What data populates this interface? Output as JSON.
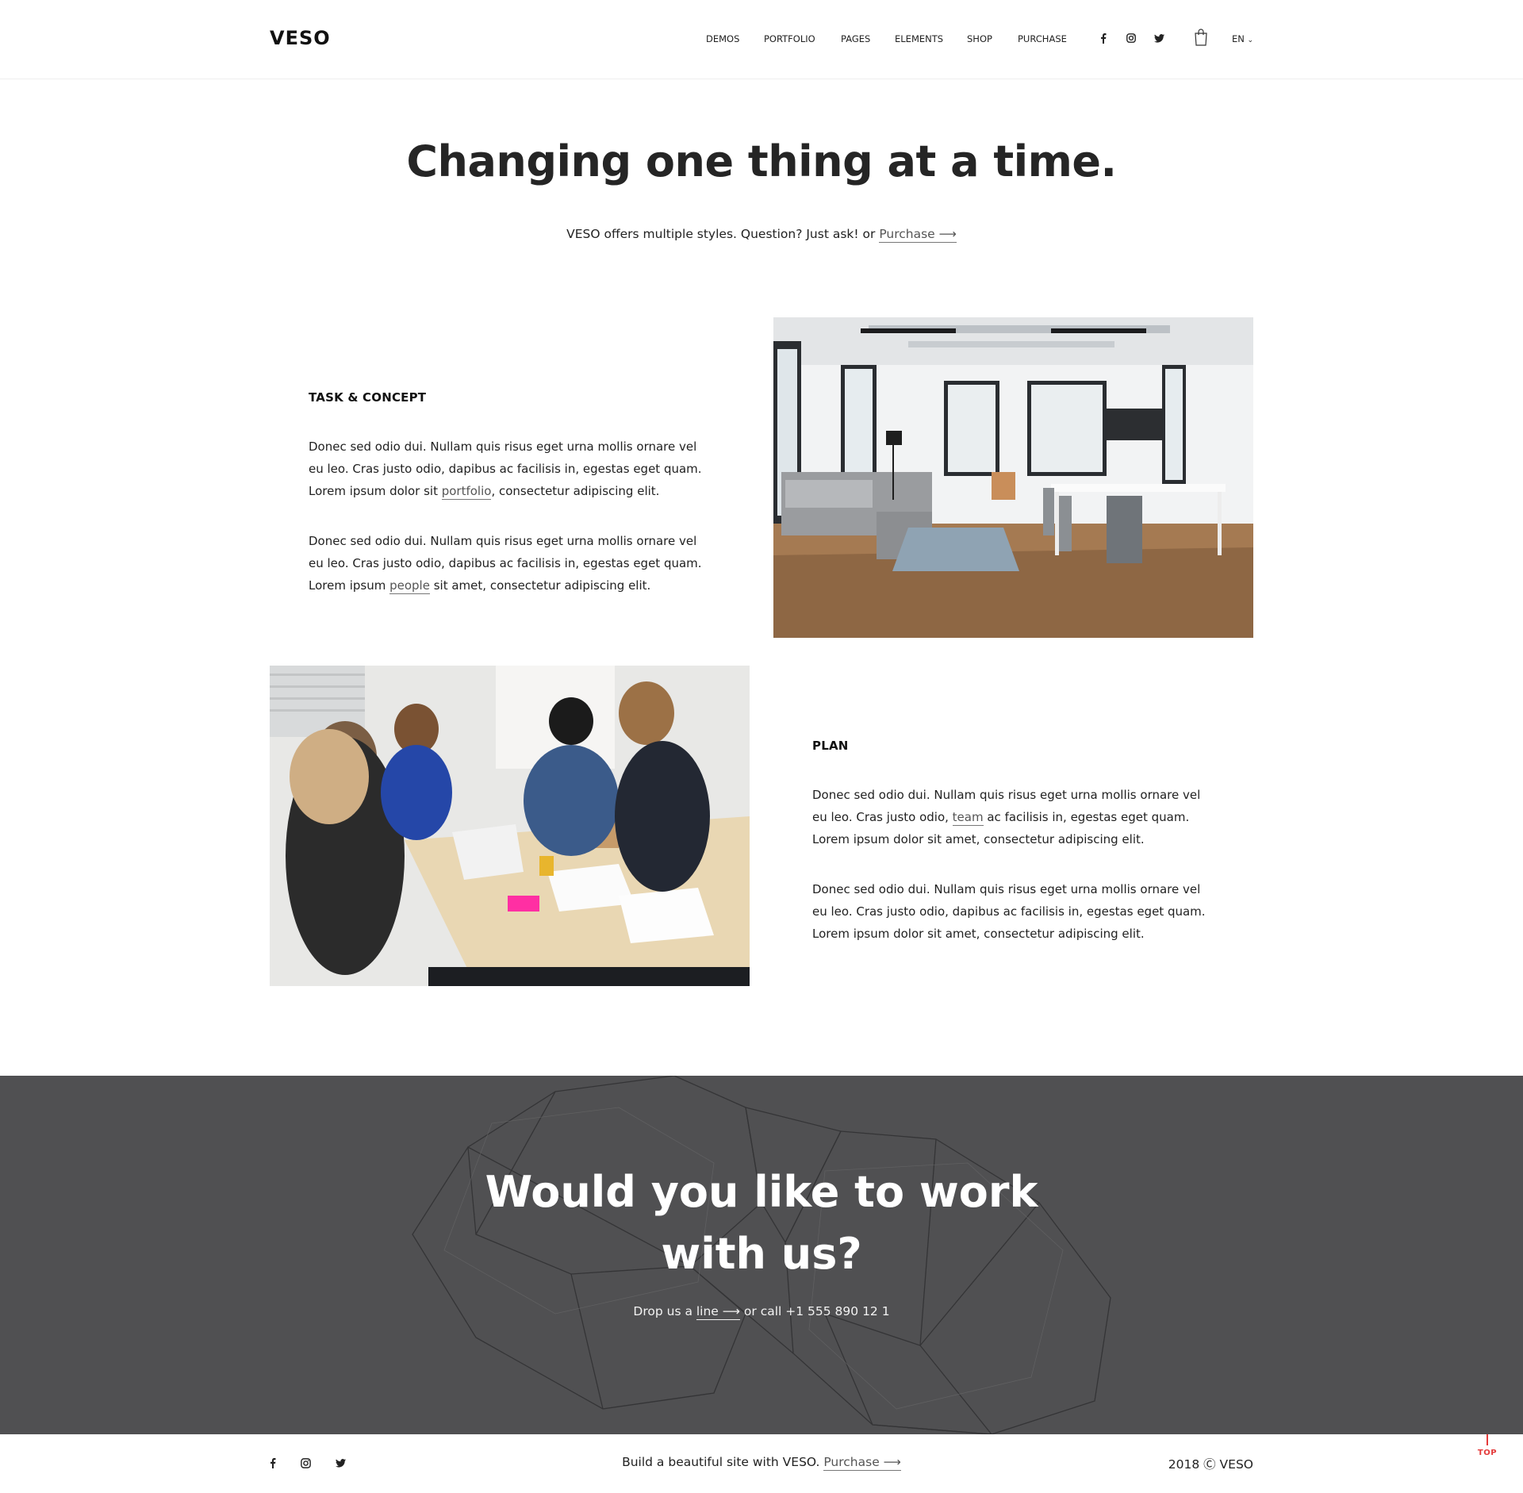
{
  "header": {
    "logo": "VESO",
    "nav": [
      "DEMOS",
      "PORTFOLIO",
      "PAGES",
      "ELEMENTS",
      "SHOP",
      "PURCHASE"
    ],
    "social_icons": [
      "facebook-icon",
      "instagram-icon",
      "twitter-icon"
    ],
    "cart_icon": "shopping-bag-icon",
    "language": "EN"
  },
  "hero": {
    "title": "Changing one thing at a time.",
    "subtitle_prefix": "VESO offers multiple styles. Question? Just ask! or ",
    "subtitle_link": "Purchase ⟶"
  },
  "section1": {
    "title": "TASK & CONCEPT",
    "p1_before": "Donec sed odio dui. Nullam quis risus eget urna mollis ornare vel eu leo. Cras justo odio, dapibus ac facilisis in, egestas eget quam. Lorem ipsum dolor sit ",
    "p1_link": "portfolio",
    "p1_after": ", consectetur adipiscing elit.",
    "p2_before": "Donec sed odio dui. Nullam quis risus eget urna mollis ornare vel eu leo. Cras justo odio, dapibus ac facilisis in, egestas eget quam. Lorem ipsum ",
    "p2_link": "people",
    "p2_after": " sit amet, consectetur adipiscing elit.",
    "image": "office-interior-photo"
  },
  "section2": {
    "title": "PLAN",
    "p1_before": "Donec sed odio dui. Nullam quis risus eget urna mollis ornare vel eu leo. Cras justo odio, ",
    "p1_link": "team",
    "p1_after": " ac facilisis in, egestas eget quam. Lorem ipsum dolor sit amet, consectetur adipiscing elit.",
    "p2": "Donec sed odio dui. Nullam quis risus eget urna mollis ornare vel eu leo. Cras justo odio, dapibus ac facilisis in, egestas eget quam. Lorem ipsum dolor sit amet, consectetur adipiscing elit.",
    "image": "team-meeting-photo"
  },
  "cta": {
    "title": "Would you like to work with us?",
    "sub_prefix": "Drop us a ",
    "sub_link": "line ⟶",
    "sub_suffix": " or call +1 555 890 12 1"
  },
  "footer": {
    "social_icons": [
      "facebook-icon",
      "instagram-icon",
      "twitter-icon"
    ],
    "text_prefix": "Build a beautiful site with VESO. ",
    "text_link": "Purchase ⟶",
    "copyright": "2018 Ⓒ VESO",
    "top_label": "TOP"
  },
  "colors": {
    "cta_background": "#505052",
    "top_accent": "#e43a3a"
  }
}
